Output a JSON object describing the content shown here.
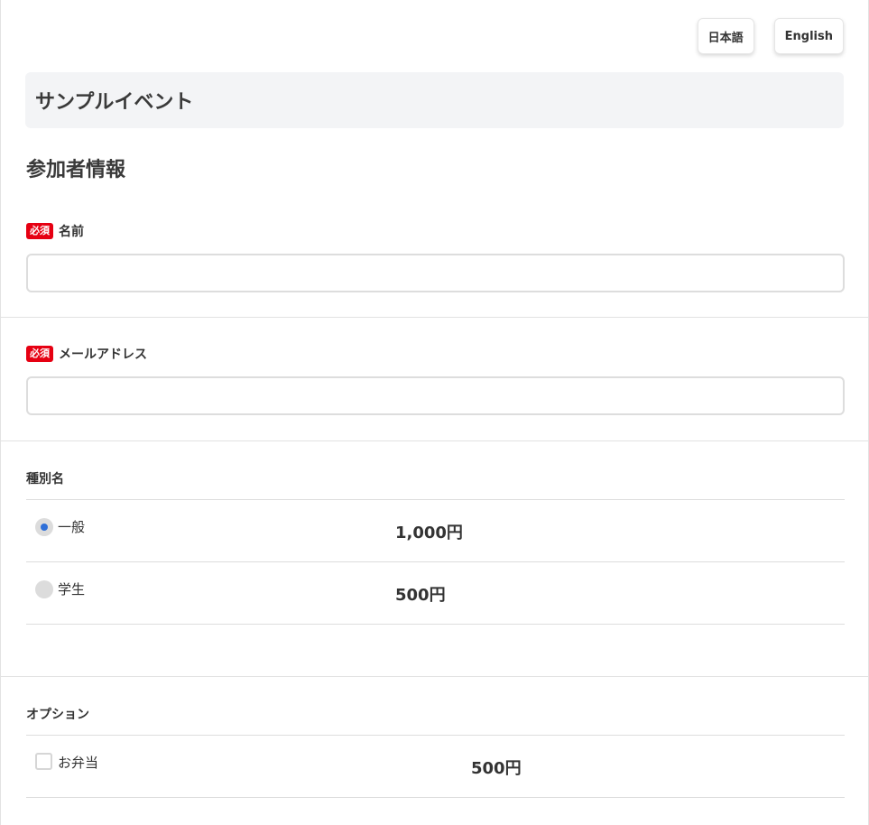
{
  "language": {
    "japanese_label": "日本語",
    "english_label": "English"
  },
  "event": {
    "title": "サンプルイベント"
  },
  "participant": {
    "heading": "参加者情報",
    "required_badge": "必須",
    "name_label": "名前",
    "name_value": "",
    "email_label": "メールアドレス",
    "email_value": ""
  },
  "ticket_type": {
    "label": "種別名",
    "options": [
      {
        "name": "一般",
        "price": "1,000円",
        "selected": true
      },
      {
        "name": "学生",
        "price": "500円",
        "selected": false
      }
    ]
  },
  "options": {
    "label": "オプション",
    "items": [
      {
        "name": "お弁当",
        "price": "500円",
        "checked": false
      }
    ]
  },
  "colors": {
    "required_badge": "#e60012",
    "radio_selected": "#2f6fd8",
    "title_box_bg": "#f3f4f6"
  }
}
